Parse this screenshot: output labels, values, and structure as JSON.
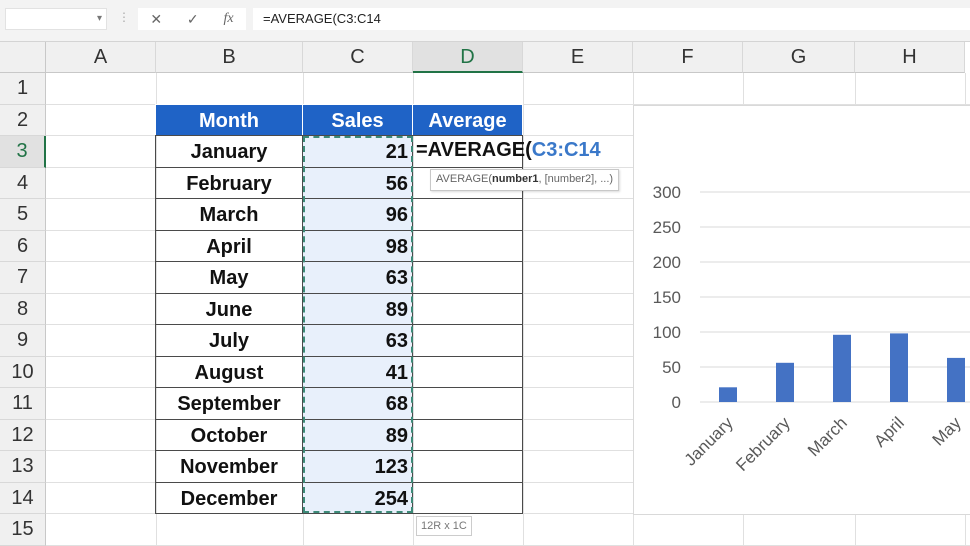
{
  "formula_bar": {
    "name_box": "",
    "cancel_icon": "✕",
    "enter_icon": "✓",
    "fx_label": "fx",
    "formula": "=AVERAGE(C3:C14"
  },
  "columns": [
    "A",
    "B",
    "C",
    "D",
    "E",
    "F",
    "G",
    "H"
  ],
  "selected_column": "D",
  "rows": [
    "1",
    "2",
    "3",
    "4",
    "5",
    "6",
    "7",
    "8",
    "9",
    "10",
    "11",
    "12",
    "13",
    "14",
    "15"
  ],
  "selected_row": "3",
  "table": {
    "headers": [
      "Month",
      "Sales",
      "Average"
    ],
    "rows": [
      [
        "January",
        "21"
      ],
      [
        "February",
        "56"
      ],
      [
        "March",
        "96"
      ],
      [
        "April",
        "98"
      ],
      [
        "May",
        "63"
      ],
      [
        "June",
        "89"
      ],
      [
        "July",
        "63"
      ],
      [
        "August",
        "41"
      ],
      [
        "September",
        "68"
      ],
      [
        "October",
        "89"
      ],
      [
        "November",
        "123"
      ],
      [
        "December",
        "254"
      ]
    ]
  },
  "editing": {
    "prefix": "=AVERAGE(",
    "range": "C3:C14",
    "range_color": "#3a78c9"
  },
  "tooltip": {
    "fn": "AVERAGE(",
    "arg1": "number1",
    "rest": ", [number2], ...)"
  },
  "size_tip": "12R x 1C",
  "colors": {
    "header_fill": "#1f63c6",
    "bar": "#4472c4",
    "marquee": "#3c8a78"
  },
  "chart_data": {
    "type": "bar",
    "categories": [
      "January",
      "February",
      "March",
      "April",
      "May"
    ],
    "values": [
      21,
      56,
      96,
      98,
      63
    ],
    "ylim": [
      0,
      300
    ],
    "yticks": [
      0,
      50,
      100,
      150,
      200,
      250,
      300
    ],
    "grid": true
  }
}
